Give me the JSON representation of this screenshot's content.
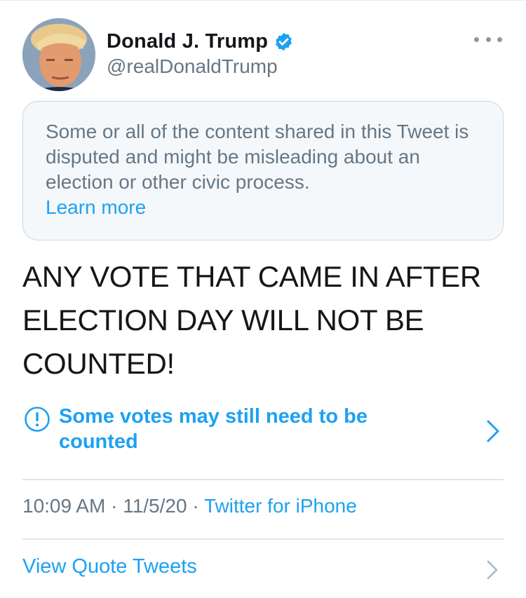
{
  "author": {
    "display_name": "Donald J. Trump",
    "handle": "@realDonaldTrump",
    "verified": true
  },
  "notice": {
    "text": "Some or all of the content shared in this Tweet is disputed and might be misleading about an election or other civic process.",
    "link": "Learn more"
  },
  "tweet": {
    "text": "ANY VOTE THAT CAME IN AFTER ELECTION DAY WILL NOT BE COUNTED!"
  },
  "label": {
    "text": "Some votes may still need to be counted"
  },
  "meta": {
    "time": "10:09 AM",
    "separator": " · ",
    "date": "11/5/20",
    "source": "Twitter for iPhone"
  },
  "actions": {
    "quote_tweets": "View Quote Tweets"
  },
  "colors": {
    "accent": "#1da1f2",
    "secondary_text": "#657786",
    "notice_bg": "#f5f8fa"
  },
  "icons": [
    "verified-badge-icon",
    "more-icon",
    "info-icon",
    "chevron-right-icon"
  ]
}
